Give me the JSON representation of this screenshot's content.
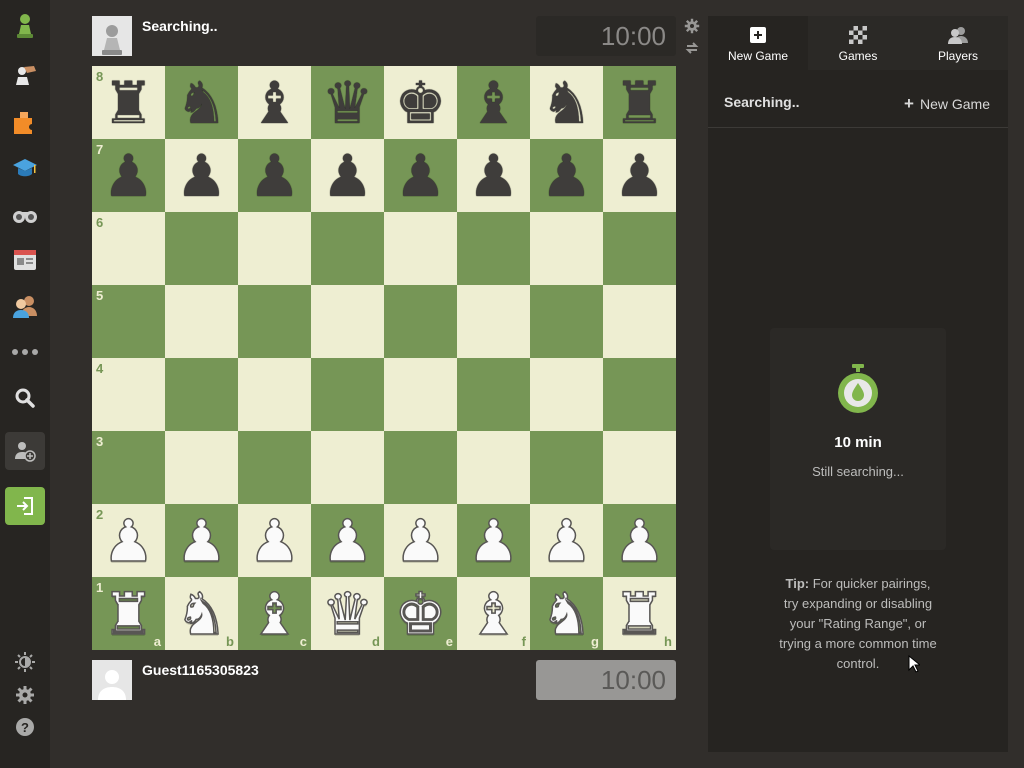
{
  "sidebar": {
    "items": [
      {
        "name": "play",
        "icon": "pawn-icon"
      },
      {
        "name": "puzzles",
        "icon": "puzzle-hand-icon"
      },
      {
        "name": "puzzle",
        "icon": "puzzle-piece-icon"
      },
      {
        "name": "learn",
        "icon": "graduation-cap-icon"
      },
      {
        "name": "watch",
        "icon": "binoculars-icon"
      },
      {
        "name": "news",
        "icon": "newspaper-icon"
      },
      {
        "name": "social",
        "icon": "people-icon"
      },
      {
        "name": "more",
        "icon": "more-dots-icon"
      },
      {
        "name": "search",
        "icon": "search-icon"
      },
      {
        "name": "sign-up",
        "icon": "add-user-icon"
      },
      {
        "name": "login",
        "icon": "login-icon"
      }
    ],
    "bottom": [
      {
        "name": "theme",
        "icon": "brightness-icon"
      },
      {
        "name": "settings",
        "icon": "gear-icon"
      },
      {
        "name": "help",
        "icon": "help-icon"
      }
    ]
  },
  "opponent": {
    "name": "Searching..",
    "clock": "10:00"
  },
  "player": {
    "name": "Guest1165305823",
    "clock": "10:00"
  },
  "board": {
    "ranks": [
      "8",
      "7",
      "6",
      "5",
      "4",
      "3",
      "2",
      "1"
    ],
    "files": [
      "a",
      "b",
      "c",
      "d",
      "e",
      "f",
      "g",
      "h"
    ],
    "position": [
      [
        "br",
        "bn",
        "bb",
        "bq",
        "bk",
        "bb",
        "bn",
        "br"
      ],
      [
        "bp",
        "bp",
        "bp",
        "bp",
        "bp",
        "bp",
        "bp",
        "bp"
      ],
      [
        "",
        "",
        "",
        "",
        "",
        "",
        "",
        ""
      ],
      [
        "",
        "",
        "",
        "",
        "",
        "",
        "",
        ""
      ],
      [
        "",
        "",
        "",
        "",
        "",
        "",
        "",
        ""
      ],
      [
        "",
        "",
        "",
        "",
        "",
        "",
        "",
        ""
      ],
      [
        "wp",
        "wp",
        "wp",
        "wp",
        "wp",
        "wp",
        "wp",
        "wp"
      ],
      [
        "wr",
        "wn",
        "wb",
        "wq",
        "wk",
        "wb",
        "wn",
        "wr"
      ]
    ],
    "colors": {
      "light": "#eeeed2",
      "dark": "#769656"
    }
  },
  "panel": {
    "tabs": [
      {
        "label": "New Game",
        "icon": "plus-square-icon",
        "active": true
      },
      {
        "label": "Games",
        "icon": "checkerboard-icon",
        "active": false
      },
      {
        "label": "Players",
        "icon": "players-icon",
        "active": false
      }
    ],
    "status": "Searching..",
    "new_game_link": "New Game",
    "search_card": {
      "time": "10 min",
      "status": "Still searching..."
    },
    "tip_prefix": "Tip:",
    "tip_text": " For quicker pairings, try expanding or disabling your \"Rating Range\", or trying a more common time control."
  }
}
